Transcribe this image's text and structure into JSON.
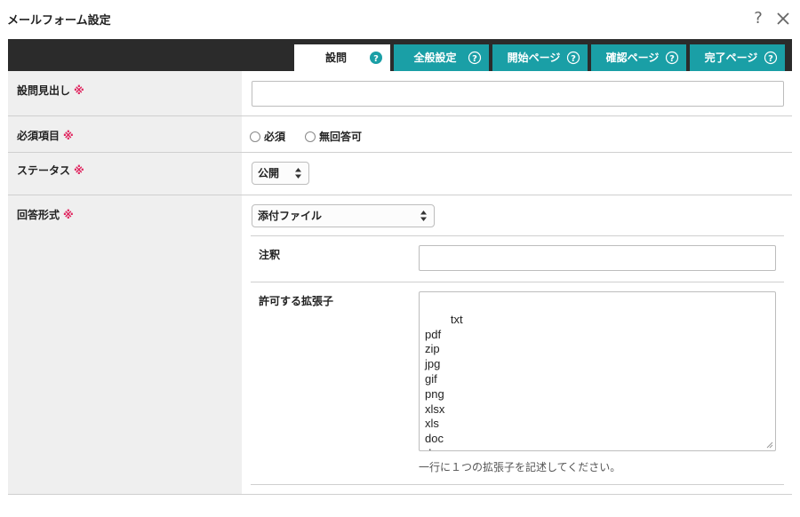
{
  "dialog": {
    "title": "メールフォーム設定",
    "help_symbol": "?"
  },
  "tabs": [
    {
      "label": "設問",
      "active": true
    },
    {
      "label": "全般設定",
      "active": false
    },
    {
      "label": "開始ページ",
      "active": false
    },
    {
      "label": "確認ページ",
      "active": false
    },
    {
      "label": "完了ページ",
      "active": false
    }
  ],
  "required_mark": "※",
  "fields": {
    "heading": {
      "label": "設問見出し",
      "value": ""
    },
    "required": {
      "label": "必須項目",
      "options": [
        "必須",
        "無回答可"
      ]
    },
    "status": {
      "label": "ステータス",
      "selected": "公開"
    },
    "answer_type": {
      "label": "回答形式",
      "selected": "添付ファイル"
    },
    "note": {
      "label": "注釈",
      "value": ""
    },
    "extensions": {
      "label": "許可する拡張子",
      "value": "txt\npdf\nzip\njpg\ngif\npng\nxlsx\nxls\ndoc\ndocx",
      "hint": "一行に１つの拡張子を記述してください。"
    }
  },
  "colors": {
    "tab_active_bg": "#ffffff",
    "tab_inactive_bg": "#1a9fa6",
    "tab_bar_bg": "#2b2b2b",
    "label_cell_bg": "#efefef",
    "required_mark": "#e0245e"
  },
  "icons": {
    "help": "question-mark-icon",
    "close": "close-icon",
    "tab_help": "question-circle-icon",
    "select_arrows": "updown-arrows-icon"
  }
}
